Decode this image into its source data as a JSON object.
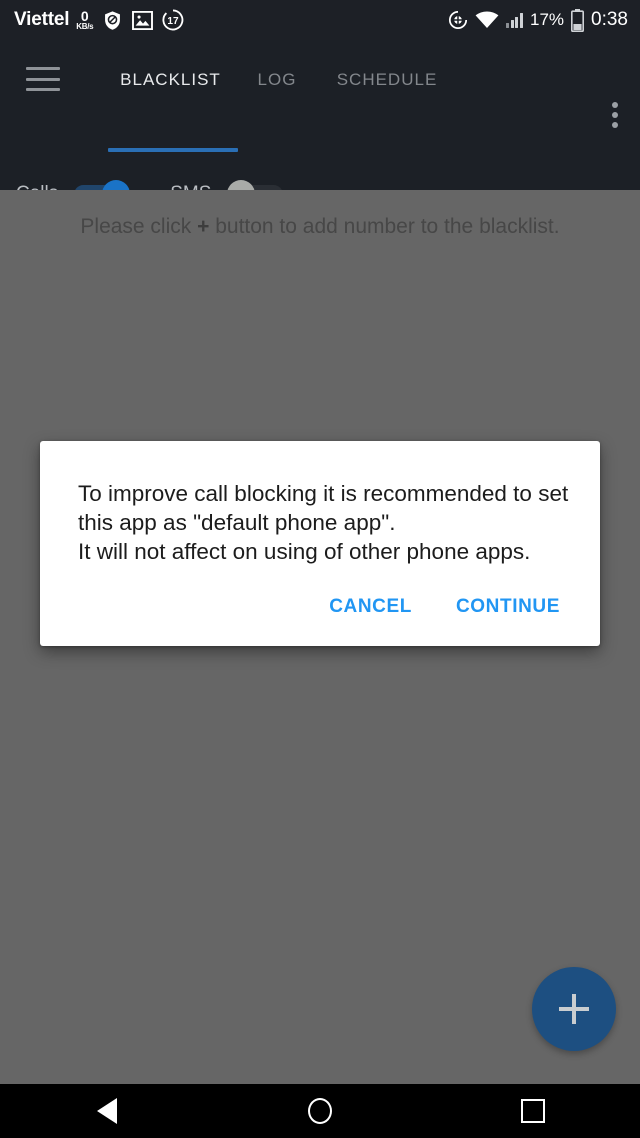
{
  "statusbar": {
    "carrier": "Viettel",
    "data_rate_value": "0",
    "data_rate_unit": "KB/s",
    "icons": [
      "block-shield-icon",
      "image-icon",
      "notification-count-icon"
    ],
    "notification_count": "17",
    "location_icon": "location-icon",
    "wifi_icon": "wifi-icon",
    "signal_icon": "cellular-signal-icon",
    "battery_percent": "17%",
    "battery_icon": "battery-icon",
    "clock": "0:38"
  },
  "appbar": {
    "menu_icon": "hamburger-menu-icon",
    "overflow_icon": "overflow-menu-icon",
    "tabs": [
      {
        "label": "BLACKLIST",
        "active": true
      },
      {
        "label": "LOG",
        "active": false
      },
      {
        "label": "SCHEDULE",
        "active": false
      }
    ],
    "accent_color": "#2a6fb5",
    "filters": {
      "calls_label": "Calls",
      "calls_enabled": "on",
      "sms_label": "SMS",
      "sms_enabled": "off",
      "expand_icon": "chevron-down-icon"
    }
  },
  "content": {
    "empty_message_before": "Please click ",
    "empty_message_plus": "+",
    "empty_message_after": " button to add number to the blacklist.",
    "fab_icon": "plus-icon",
    "fab_color": "#1d4f81"
  },
  "dialog": {
    "message": "To improve call blocking it is recommended to set this app as \"default phone app\".\nIt will not affect on using of other phone apps.",
    "cancel_label": "CANCEL",
    "continue_label": "CONTINUE",
    "button_color": "#2196f3"
  },
  "navbar": {
    "back_icon": "back-triangle-icon",
    "home_icon": "home-circle-icon",
    "recents_icon": "recents-square-icon"
  }
}
